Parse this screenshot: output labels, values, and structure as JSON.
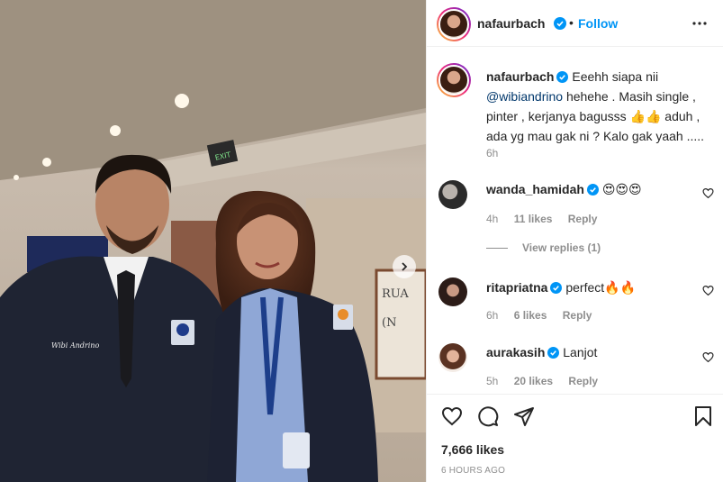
{
  "post": {
    "photo_alt": "",
    "name_tag_text": "Wibi Andrino"
  },
  "header": {
    "username": "nafaurbach",
    "separator": "•",
    "follow_label": "Follow",
    "more_icon": "more-horizontal-icon"
  },
  "caption": {
    "username": "nafaurbach",
    "text_before_mention": "Eeehh siapa nii",
    "mention": "@wibiandrino",
    "text_after_mention": "hehehe . Masih single , pinter , kerjanya bagusss 👍👍 aduh , ada yg mau gak ni ? Kalo gak yaah .....",
    "time": "6h"
  },
  "comments": [
    {
      "username": "wanda_hamidah",
      "text": "😍😍😍",
      "time": "4h",
      "likes": "11 likes",
      "reply": "Reply"
    },
    {
      "username": "ritapriatna",
      "text": "perfect🔥🔥",
      "time": "6h",
      "likes": "6 likes",
      "reply": "Reply"
    },
    {
      "username": "aurakasih",
      "text": "Lanjot",
      "time": "5h",
      "likes": "20 likes",
      "reply": "Reply"
    }
  ],
  "view_replies": "View replies (1)",
  "actions": {
    "likes": "7,666 likes",
    "posted_ago": "6 HOURS AGO"
  },
  "colors": {
    "accent": "#0095f6",
    "verified": "#0095f6",
    "mention": "#00376b",
    "muted": "#8e8e8e"
  }
}
